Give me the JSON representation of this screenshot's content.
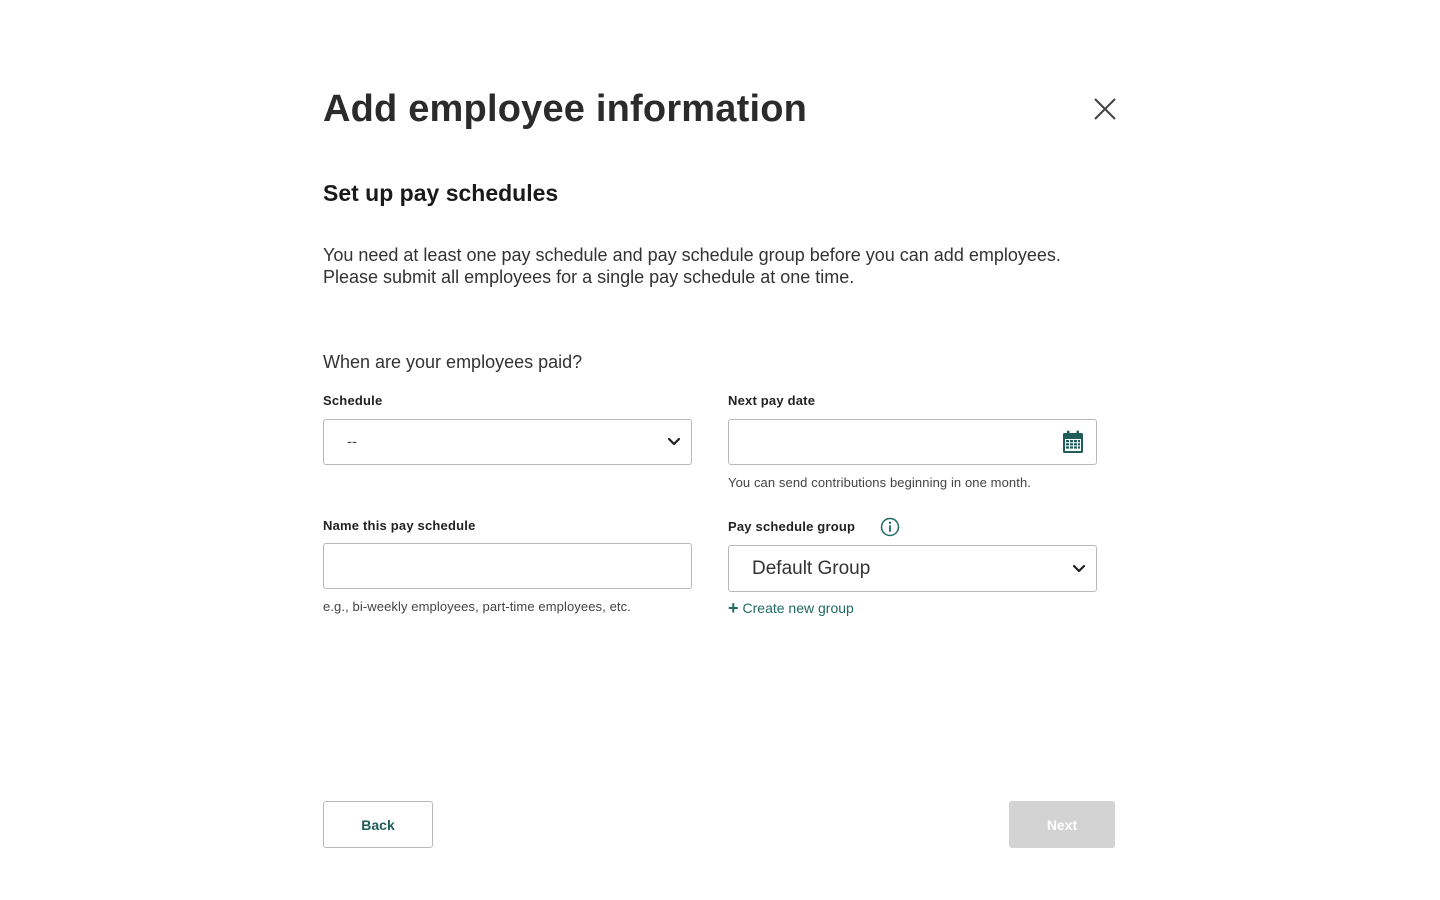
{
  "modal": {
    "title": "Add employee information",
    "subtitle": "Set up pay schedules",
    "intro": "You need at least one pay schedule and pay schedule group before you can add employees. Please submit all employees for a single pay schedule at one time.",
    "question": "When are your employees paid?"
  },
  "fields": {
    "schedule": {
      "label": "Schedule",
      "selected": "--"
    },
    "next_pay_date": {
      "label": "Next pay date",
      "value": "",
      "help": "You can send contributions beginning in one month."
    },
    "schedule_name": {
      "label": "Name this pay schedule",
      "value": "",
      "help": "e.g., bi-weekly employees, part-time employees, etc."
    },
    "pay_schedule_group": {
      "label": "Pay schedule group",
      "selected": "Default Group",
      "create_link": "Create new group"
    }
  },
  "actions": {
    "back_label": "Back",
    "next_label": "Next"
  },
  "colors": {
    "accent": "#1f6b61",
    "disabled": "#d3d3d3",
    "border": "#b8b8b8",
    "calendar_icon": "#1f5d58"
  },
  "icons": {
    "close": "close-icon",
    "schedule_dropdown": "chevron-down-icon",
    "date_picker": "calendar-icon",
    "group_info": "info-icon",
    "group_dropdown": "chevron-down-icon",
    "create_group": "plus-icon"
  }
}
